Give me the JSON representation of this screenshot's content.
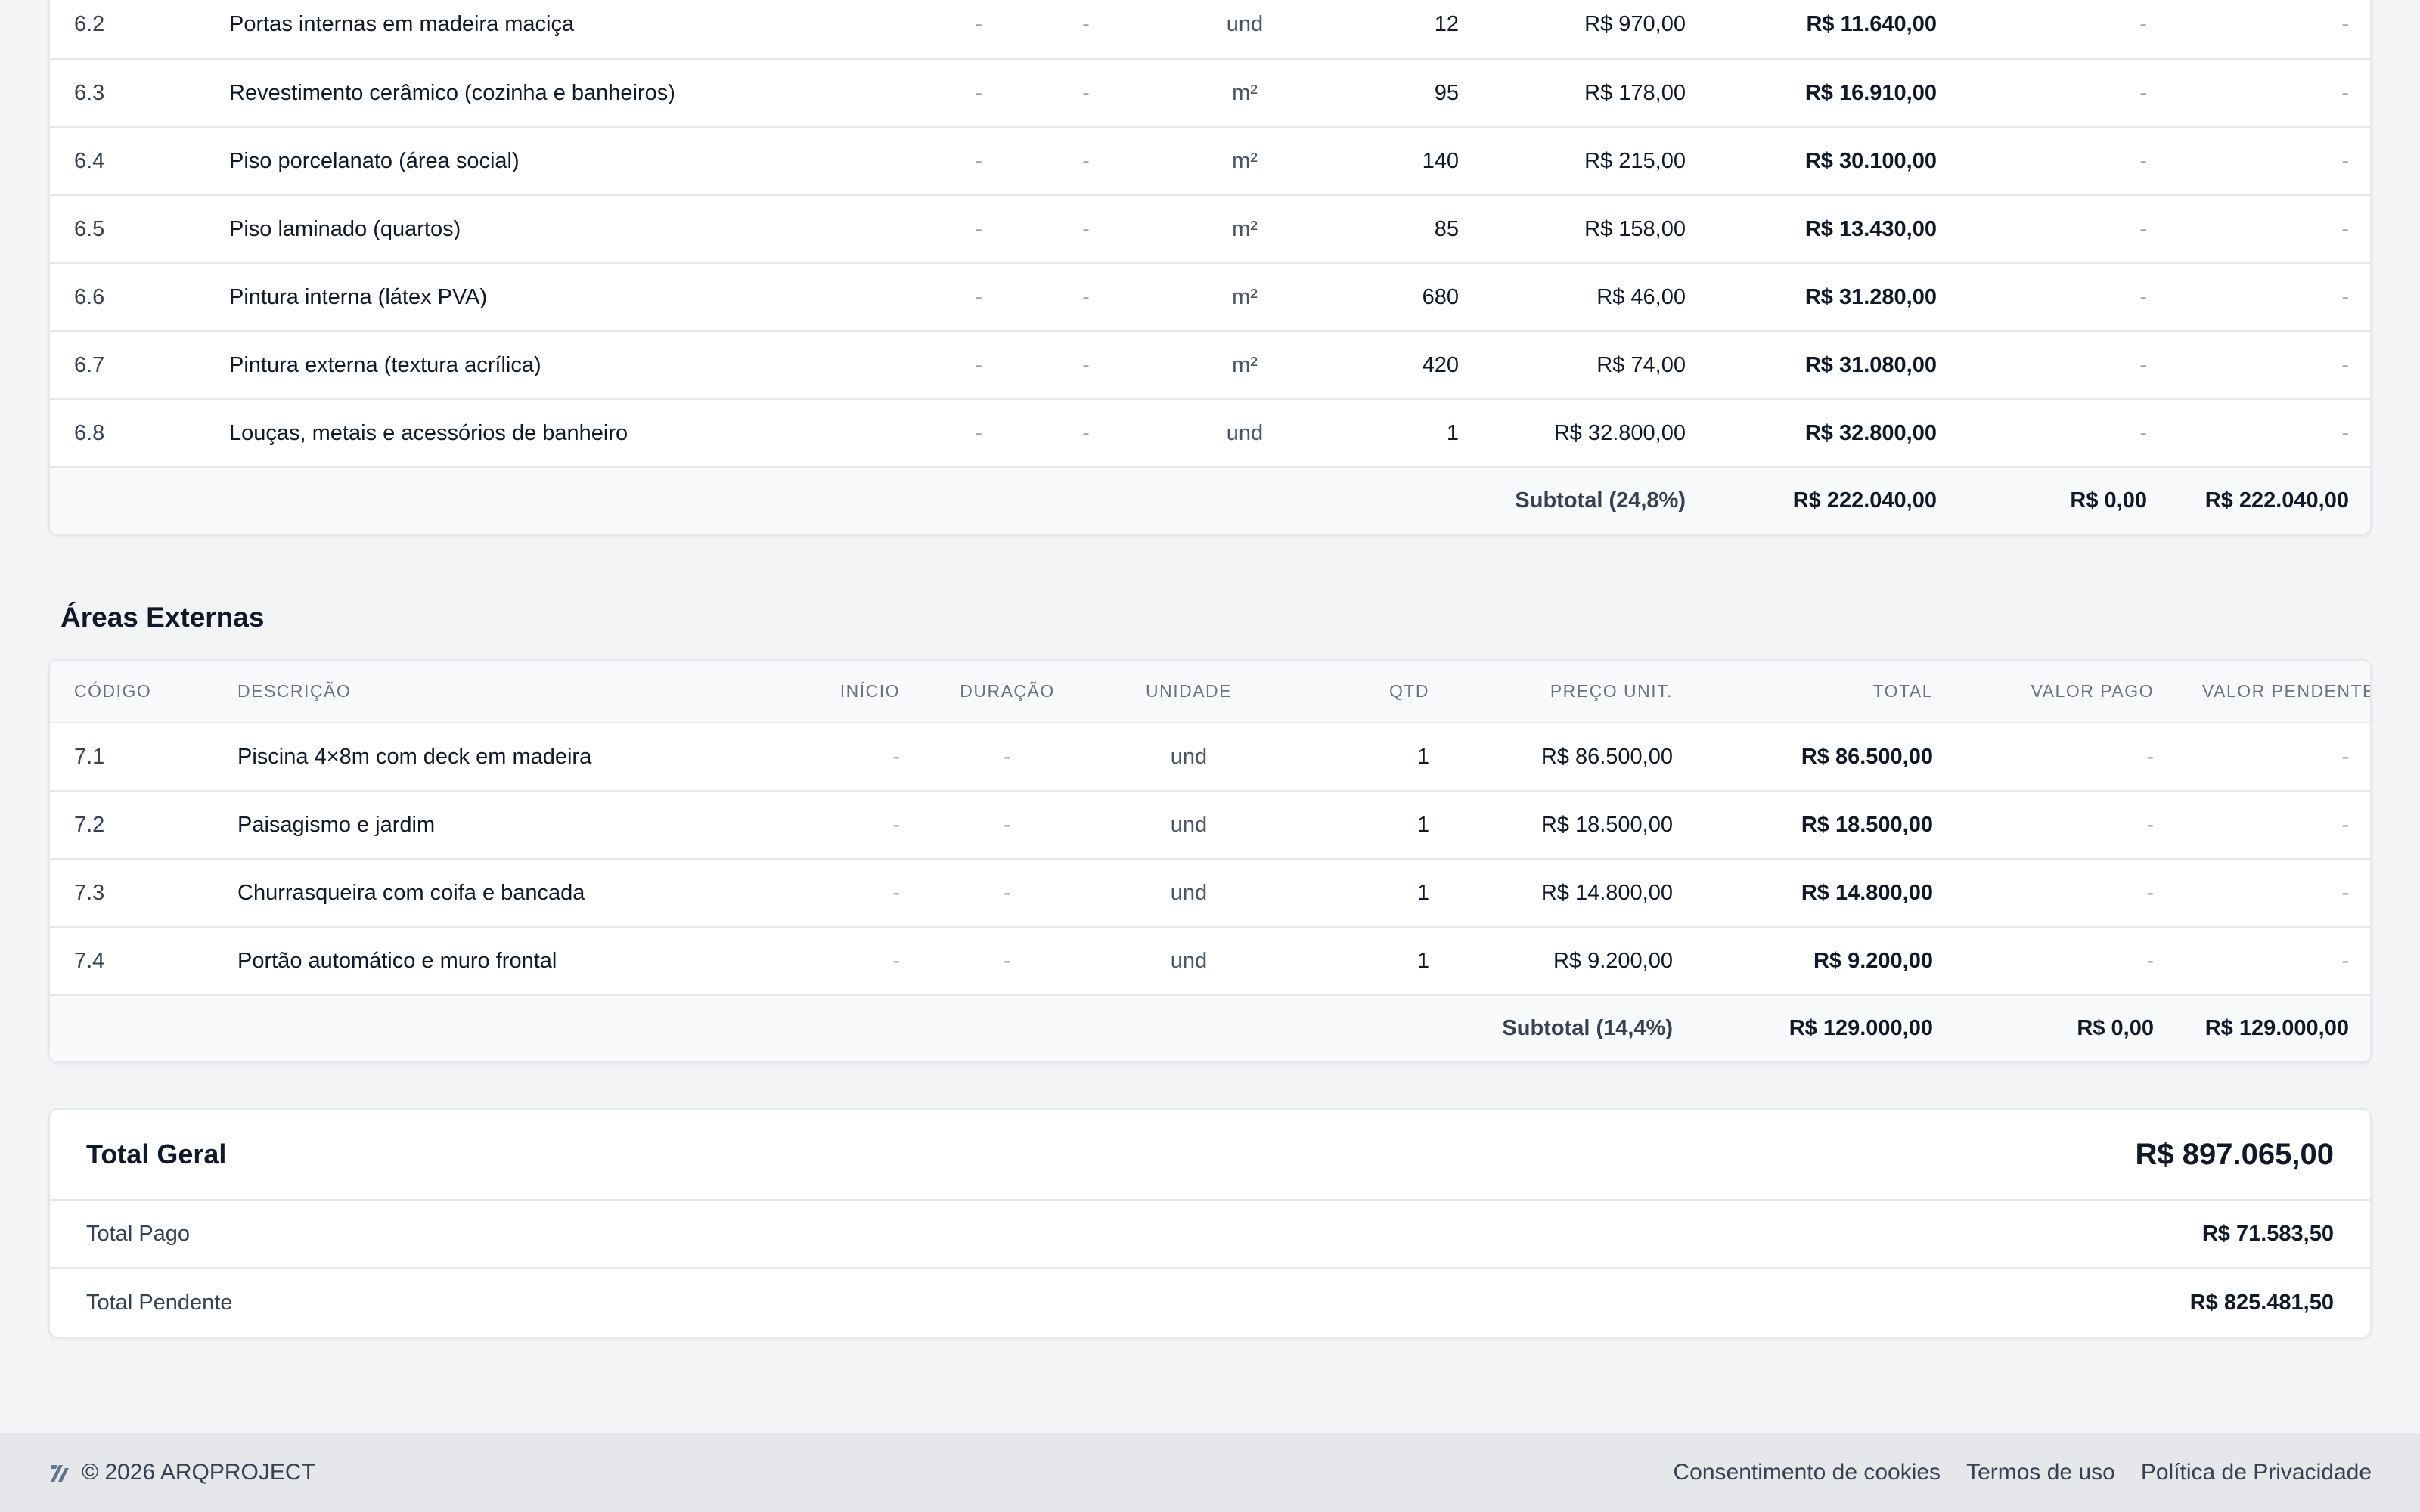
{
  "section6": {
    "rows": [
      {
        "code": "6.2",
        "desc": "Portas internas em madeira maciça",
        "inicio": "-",
        "duracao": "-",
        "unidade": "und",
        "qtd": "12",
        "preco": "R$ 970,00",
        "total": "R$ 11.640,00",
        "pago": "-",
        "pendente": "-"
      },
      {
        "code": "6.3",
        "desc": "Revestimento cerâmico (cozinha e banheiros)",
        "inicio": "-",
        "duracao": "-",
        "unidade": "m²",
        "qtd": "95",
        "preco": "R$ 178,00",
        "total": "R$ 16.910,00",
        "pago": "-",
        "pendente": "-"
      },
      {
        "code": "6.4",
        "desc": "Piso porcelanato (área social)",
        "inicio": "-",
        "duracao": "-",
        "unidade": "m²",
        "qtd": "140",
        "preco": "R$ 215,00",
        "total": "R$ 30.100,00",
        "pago": "-",
        "pendente": "-"
      },
      {
        "code": "6.5",
        "desc": "Piso laminado (quartos)",
        "inicio": "-",
        "duracao": "-",
        "unidade": "m²",
        "qtd": "85",
        "preco": "R$ 158,00",
        "total": "R$ 13.430,00",
        "pago": "-",
        "pendente": "-"
      },
      {
        "code": "6.6",
        "desc": "Pintura interna (látex PVA)",
        "inicio": "-",
        "duracao": "-",
        "unidade": "m²",
        "qtd": "680",
        "preco": "R$ 46,00",
        "total": "R$ 31.280,00",
        "pago": "-",
        "pendente": "-"
      },
      {
        "code": "6.7",
        "desc": "Pintura externa (textura acrílica)",
        "inicio": "-",
        "duracao": "-",
        "unidade": "m²",
        "qtd": "420",
        "preco": "R$ 74,00",
        "total": "R$ 31.080,00",
        "pago": "-",
        "pendente": "-"
      },
      {
        "code": "6.8",
        "desc": "Louças, metais e acessórios de banheiro",
        "inicio": "-",
        "duracao": "-",
        "unidade": "und",
        "qtd": "1",
        "preco": "R$ 32.800,00",
        "total": "R$ 32.800,00",
        "pago": "-",
        "pendente": "-"
      }
    ],
    "subtotal": {
      "label": "Subtotal (24,8%)",
      "total": "R$ 222.040,00",
      "pago": "R$ 0,00",
      "pendente": "R$ 222.040,00"
    }
  },
  "section7": {
    "title": "Áreas Externas",
    "headers": {
      "codigo": "Código",
      "descricao": "Descrição",
      "inicio": "Início",
      "duracao": "Duração",
      "unidade": "Unidade",
      "qtd": "Qtd",
      "preco": "Preço Unit.",
      "total": "Total",
      "pago": "Valor Pago",
      "pendente": "Valor Pendente"
    },
    "rows": [
      {
        "code": "7.1",
        "desc": "Piscina 4×8m com deck em madeira",
        "inicio": "-",
        "duracao": "-",
        "unidade": "und",
        "qtd": "1",
        "preco": "R$ 86.500,00",
        "total": "R$ 86.500,00",
        "pago": "-",
        "pendente": "-"
      },
      {
        "code": "7.2",
        "desc": "Paisagismo e jardim",
        "inicio": "-",
        "duracao": "-",
        "unidade": "und",
        "qtd": "1",
        "preco": "R$ 18.500,00",
        "total": "R$ 18.500,00",
        "pago": "-",
        "pendente": "-"
      },
      {
        "code": "7.3",
        "desc": "Churrasqueira com coifa e bancada",
        "inicio": "-",
        "duracao": "-",
        "unidade": "und",
        "qtd": "1",
        "preco": "R$ 14.800,00",
        "total": "R$ 14.800,00",
        "pago": "-",
        "pendente": "-"
      },
      {
        "code": "7.4",
        "desc": "Portão automático e muro frontal",
        "inicio": "-",
        "duracao": "-",
        "unidade": "und",
        "qtd": "1",
        "preco": "R$ 9.200,00",
        "total": "R$ 9.200,00",
        "pago": "-",
        "pendente": "-"
      }
    ],
    "subtotal": {
      "label": "Subtotal (14,4%)",
      "total": "R$ 129.000,00",
      "pago": "R$ 0,00",
      "pendente": "R$ 129.000,00"
    }
  },
  "totals": {
    "geral_label": "Total Geral",
    "geral_value": "R$ 897.065,00",
    "pago_label": "Total Pago",
    "pago_value": "R$ 71.583,50",
    "pendente_label": "Total Pendente",
    "pendente_value": "R$ 825.481,50"
  },
  "footer": {
    "copyright": "© 2026 ARQPROJECT",
    "logo_icon": "arqproject-logo-icon",
    "links": [
      "Consentimento de cookies",
      "Termos de uso",
      "Política de Privacidade"
    ]
  }
}
